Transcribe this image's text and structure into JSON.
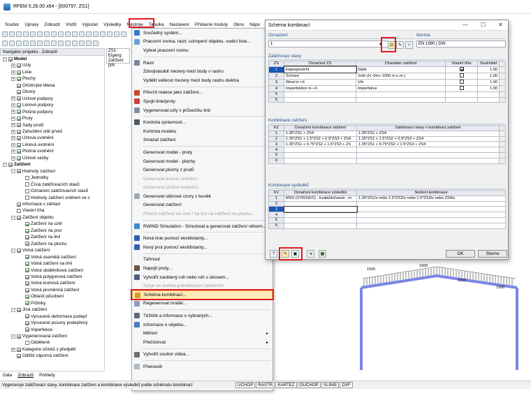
{
  "app": {
    "title": "RFEM 5.26.00 x64 - [000797, ZS1]"
  },
  "menubar": [
    "Soubor",
    "Úpravy",
    "Zobrazit",
    "Vložit",
    "Výpočet",
    "Výsledky",
    "Nástroje",
    "Tabulka",
    "Nastavení",
    "Přídavné moduly",
    "Okno",
    "Nápo"
  ],
  "navigator": {
    "title": "Navigátor projektu - Zobrazit",
    "tabs": [
      "Data",
      "Zobrazit",
      "Pohledy"
    ],
    "items": [
      {
        "label": "Model",
        "level": 0,
        "expand": "-",
        "checked": true
      },
      {
        "label": "Uzly",
        "level": 1,
        "expand": "+",
        "checked": true
      },
      {
        "label": "Linie",
        "level": 1,
        "expand": "+",
        "checked": true
      },
      {
        "label": "Plochy",
        "level": 1,
        "expand": "+",
        "checked": true
      },
      {
        "label": "Ortotropie tělesa",
        "level": 1,
        "expand": "",
        "checked": true
      },
      {
        "label": "Otvory",
        "level": 1,
        "expand": "",
        "checked": true
      },
      {
        "label": "Uzlové podpory",
        "level": 1,
        "expand": "+",
        "checked": true
      },
      {
        "label": "Liniové podpory",
        "level": 1,
        "expand": "+",
        "checked": true
      },
      {
        "label": "Plošné podpory",
        "level": 1,
        "expand": "+",
        "checked": true
      },
      {
        "label": "Pruty",
        "level": 1,
        "expand": "+",
        "checked": true
      },
      {
        "label": "Sady prutů",
        "level": 1,
        "expand": "+",
        "checked": true
      },
      {
        "label": "Zahuštění sítě prvků",
        "level": 1,
        "expand": "+",
        "checked": true
      },
      {
        "label": "Uzlová uvolnění",
        "level": 1,
        "expand": "+",
        "checked": true
      },
      {
        "label": "Liniová uvolnění",
        "level": 1,
        "expand": "+",
        "checked": true
      },
      {
        "label": "Plošná uvolnění",
        "level": 1,
        "expand": "+",
        "checked": true
      },
      {
        "label": "Uzlové vazby",
        "level": 1,
        "expand": "+",
        "checked": true
      },
      {
        "label": "Zatížení",
        "level": 0,
        "expand": "-",
        "checked": true
      },
      {
        "label": "Hodnoty zatížení",
        "level": 1,
        "expand": "-",
        "checked": true
      },
      {
        "label": "Jednotky",
        "level": 2,
        "expand": "",
        "checked": false
      },
      {
        "label": "Čísla zatěžovacích stavů",
        "level": 2,
        "expand": "",
        "checked": false
      },
      {
        "label": "Označení zatěžovacích stavů",
        "level": 2,
        "expand": "",
        "checked": false
      },
      {
        "label": "Hodnoty zatížení sněhem ve s",
        "level": 2,
        "expand": "",
        "checked": false
      },
      {
        "label": "Informace v záhlaví",
        "level": 1,
        "expand": "",
        "checked": true
      },
      {
        "label": "Vlastní tíha",
        "level": 1,
        "expand": "",
        "checked": false
      },
      {
        "label": "Zatížení objektu",
        "level": 1,
        "expand": "-",
        "checked": true
      },
      {
        "label": "Zatížení na uzel",
        "level": 2,
        "expand": "",
        "checked": true
      },
      {
        "label": "Zatížení na prut",
        "level": 2,
        "expand": "",
        "checked": true
      },
      {
        "label": "Zatížení na linii",
        "level": 2,
        "expand": "",
        "checked": true
      },
      {
        "label": "Zatížení na plochu",
        "level": 2,
        "expand": "",
        "checked": true
      },
      {
        "label": "Volná zatížení",
        "level": 1,
        "expand": "-",
        "checked": true
      },
      {
        "label": "Volná osamělá zatížení",
        "level": 2,
        "expand": "",
        "checked": true
      },
      {
        "label": "Volná zatížení na linii",
        "level": 2,
        "expand": "",
        "checked": true
      },
      {
        "label": "Volná obdélníková zatížení",
        "level": 2,
        "expand": "",
        "checked": true
      },
      {
        "label": "Volná polygonová zatížení",
        "level": 2,
        "expand": "",
        "checked": true
      },
      {
        "label": "Volná kruhová zatížení",
        "level": 2,
        "expand": "",
        "checked": true
      },
      {
        "label": "Volná proměnná zatížení",
        "level": 2,
        "expand": "",
        "checked": true
      },
      {
        "label": "Oblasti působení",
        "level": 2,
        "expand": "",
        "checked": true
      },
      {
        "label": "Průmky",
        "level": 2,
        "expand": "",
        "checked": true
      },
      {
        "label": "Jiná zatížení",
        "level": 1,
        "expand": "-",
        "checked": true
      },
      {
        "label": "Vynucené deformace podepř",
        "level": 2,
        "expand": "",
        "checked": true
      },
      {
        "label": "Vynucené posuny podepřený",
        "level": 2,
        "expand": "",
        "checked": true
      },
      {
        "label": "Imperfekce",
        "level": 2,
        "expand": "",
        "checked": true
      },
      {
        "label": "Vygenerovaná zatížení",
        "level": 1,
        "expand": "-",
        "checked": true
      },
      {
        "label": "Oddělené",
        "level": 2,
        "expand": "",
        "checked": false
      },
      {
        "label": "Kategorie účinků z předpětí",
        "level": 1,
        "expand": "+",
        "checked": true
      },
      {
        "label": "Odlišit záporná zatížení",
        "level": 1,
        "expand": "",
        "checked": true
      }
    ]
  },
  "viewport": {
    "header_line1": "ZS1 : Eigeng",
    "header_line2": "Zatížení [kN"
  },
  "menu": {
    "items": [
      {
        "label": "Souřadný systém...",
        "enabled": true,
        "icon": "coord-system-icon",
        "color": "#3a78c8"
      },
      {
        "label": "Pracovní rovina, rastr, uchopení objektu, vodicí linie...",
        "enabled": true,
        "icon": "work-plane-icon",
        "color": "#6aa0d8"
      },
      {
        "label": "Vybrat pracovní rovinu",
        "enabled": true,
        "icon": "",
        "color": ""
      },
      {
        "sep": true
      },
      {
        "label": "Rastr",
        "enabled": true,
        "icon": "grid-icon",
        "color": "#7a8a9a"
      },
      {
        "label": "Zdvojnásobit mezery mezi body v rastru",
        "enabled": true,
        "icon": "",
        "color": ""
      },
      {
        "label": "Vydělit velikost mezery mezi body rastru dvěma",
        "enabled": true,
        "icon": "",
        "color": ""
      },
      {
        "sep": true
      },
      {
        "label": "Převzít reakce jako zatížení...",
        "enabled": true,
        "icon": "reactions-icon",
        "color": "#c84a2a"
      },
      {
        "label": "Spojit linie/pruty",
        "enabled": true,
        "icon": "connect-icon",
        "color": "#d04040"
      },
      {
        "label": "Vygenerovat uzly v průsečíku linií",
        "enabled": true,
        "icon": "intersection-icon",
        "color": "#8090a0"
      },
      {
        "sep": true
      },
      {
        "label": "Kontrola správnosti...",
        "enabled": true,
        "icon": "check-icon",
        "color": "#505860"
      },
      {
        "label": "Kontrola modelu",
        "enabled": true,
        "icon": "",
        "color": ""
      },
      {
        "label": "Smazat zatížení",
        "enabled": true,
        "icon": "",
        "color": ""
      },
      {
        "sep": true
      },
      {
        "label": "Generovat model - pruty",
        "enabled": true,
        "icon": "",
        "color": ""
      },
      {
        "label": "Generovat model - plochy",
        "enabled": true,
        "icon": "",
        "color": ""
      },
      {
        "label": "Generovat plochy z prutů",
        "enabled": true,
        "icon": "",
        "color": ""
      },
      {
        "label": "Generovat liniová uvolnění...",
        "enabled": false,
        "icon": "",
        "color": ""
      },
      {
        "label": "Generovat plošná uvolnění...",
        "enabled": false,
        "icon": "",
        "color": ""
      },
      {
        "label": "Generovat stěnové vzory z buněk",
        "enabled": true,
        "icon": "wall-icon",
        "color": "#a0a8b0"
      },
      {
        "label": "Generovat zatížení",
        "enabled": true,
        "icon": "",
        "color": ""
      },
      {
        "label": "Převzít zatížení na uzel / na linii na zatížení na plochu...",
        "enabled": false,
        "icon": "",
        "color": ""
      },
      {
        "sep": true
      },
      {
        "label": "RWIND Simulation - Simulovat a generovat zatížení větrem...",
        "enabled": true,
        "icon": "rwind-icon",
        "color": "#3a8ad0"
      },
      {
        "sep": true
      },
      {
        "label": "Nová linie pomocí ekvidistanty...",
        "enabled": true,
        "icon": "new-line-icon",
        "color": "#3060b0"
      },
      {
        "label": "Nový prut pomocí ekvidistanty...",
        "enabled": true,
        "icon": "new-member-icon",
        "color": "#3060b0"
      },
      {
        "sep": true
      },
      {
        "label": "Táhnout",
        "enabled": true,
        "icon": "",
        "color": ""
      },
      {
        "label": "Napojit pruty...",
        "enabled": true,
        "icon": "join-icon",
        "color": "#705040"
      },
      {
        "label": "Vytvořit zaoblený roh nebo roh s úkosem...",
        "enabled": true,
        "icon": "fillet-icon",
        "color": "#506080"
      },
      {
        "label": "Spoje ke dvěma jednotkovým zatížením",
        "enabled": false,
        "icon": "",
        "color": ""
      },
      {
        "label": "Schéma kombinací...",
        "enabled": true,
        "icon": "combo-scheme-icon",
        "color": "#d8a020",
        "highlight": true
      },
      {
        "label": "Regenerovat model...",
        "enabled": true,
        "icon": "regenerate-icon",
        "color": "#8aa0b8"
      },
      {
        "sep": true
      },
      {
        "label": "Těžiště a informace o vybraných...",
        "enabled": true,
        "icon": "centroid-icon",
        "color": "#606a76"
      },
      {
        "label": "Informace o objektu...",
        "enabled": true,
        "icon": "info-icon",
        "color": "#4a7ac0"
      },
      {
        "label": "Měření",
        "enabled": true,
        "icon": "",
        "color": "",
        "submenu": true
      },
      {
        "label": "Přečíslovat",
        "enabled": true,
        "icon": "",
        "color": "",
        "submenu": true
      },
      {
        "sep": true
      },
      {
        "label": "Vytvořit soubor videa...",
        "enabled": true,
        "icon": "video-icon",
        "color": "#707070"
      },
      {
        "sep": true
      },
      {
        "label": "Překreslit",
        "enabled": true,
        "icon": "redraw-icon",
        "color": "#b0b8c0"
      }
    ]
  },
  "dialog": {
    "title": "Schéma kombinací",
    "oznaceni_label": "Označení",
    "oznaceni_value": "1",
    "norma_label": "Norma",
    "norma_value": "EN 1990 | DIN",
    "zs": {
      "title": "Zatěžovací stavy",
      "headers": [
        "ZS",
        "Označení ZS",
        "Charakter zatížení",
        "Vlastní tíha",
        "Součinitel"
      ],
      "rows": [
        {
          "n": "1",
          "name": "Eigengewicht",
          "char": "Stálé",
          "self": true,
          "factor": "1.00",
          "selected": true
        },
        {
          "n": "2",
          "name": "Schnee",
          "char": "Sníh (H -0m> 1000 m n.m.)",
          "self": false,
          "factor": "1.00"
        },
        {
          "n": "3",
          "name": "Wind in +X",
          "char": "Vítr",
          "self": false,
          "factor": "1.00"
        },
        {
          "n": "4",
          "name": "Imperfektion in +X",
          "char": "Imperfekce",
          "self": false,
          "factor": "1.00"
        },
        {
          "n": "5",
          "name": "",
          "char": "",
          "self": null,
          "factor": ""
        },
        {
          "n": "6",
          "name": "",
          "char": "",
          "self": null,
          "factor": ""
        }
      ]
    },
    "kz": {
      "title": "Kombinace zatížení",
      "headers": [
        "KZ",
        "Označení kombinace zatížení",
        "Zatěžovací stavy v kombinaci zatížení"
      ],
      "rows": [
        {
          "n": "1",
          "name": "1.35*ZS1 + ZS4",
          "combo": "1.35*ZS1 + ZS4"
        },
        {
          "n": "2",
          "name": "1.35*ZS1 + 1.5*ZS2 + 0.9*ZS3 + ZS4",
          "combo": "1.35*ZS1 + 1.5*ZS2 + 0.9*ZS3 + ZS4"
        },
        {
          "n": "3",
          "name": "1.35*ZS1 + 0.75*ZS2 + 1.5*ZS3 + ZS",
          "combo": "1.35*ZS1 + 0.75*ZS2 + 1.5*ZS3 + ZS4"
        },
        {
          "n": "4",
          "name": "",
          "combo": ""
        },
        {
          "n": "5",
          "name": "",
          "combo": ""
        },
        {
          "n": "6",
          "name": "",
          "combo": ""
        }
      ]
    },
    "kv": {
      "title": "Kombinace výsledků",
      "headers": [
        "KV",
        "Označení kombinace výsledků",
        "Složení kombinace"
      ],
      "rows": [
        {
          "n": "1",
          "name": "MSÚ (STR/GEO) - trvalá/dočasná - ro",
          "combo": "1.35*ZS1/s nebo 1.5*ZS2/s nebo 1.5*ZS3/s nebo ZS4/s"
        },
        {
          "n": "2",
          "name": "",
          "combo": ""
        },
        {
          "n": "3",
          "name": "",
          "combo": "",
          "active": true
        },
        {
          "n": "4",
          "name": "",
          "combo": ""
        },
        {
          "n": "5",
          "name": "",
          "combo": ""
        },
        {
          "n": "6",
          "name": "",
          "combo": ""
        }
      ]
    },
    "ok": "OK",
    "cancel": "Storno"
  },
  "drawing": {
    "labels": [
      "1500",
      "1500",
      "1500",
      "1500"
    ]
  },
  "status": {
    "message": "Vygeneruje zatěžovací stavy, kombinace zatížení a kombinace výsledků podle schématu kombinací",
    "buttons": [
      "UCHOP",
      "RASTR",
      "KARTEZ",
      "OUCHOP",
      "VLINIE",
      "DXF"
    ]
  },
  "accent": "#e21a22"
}
